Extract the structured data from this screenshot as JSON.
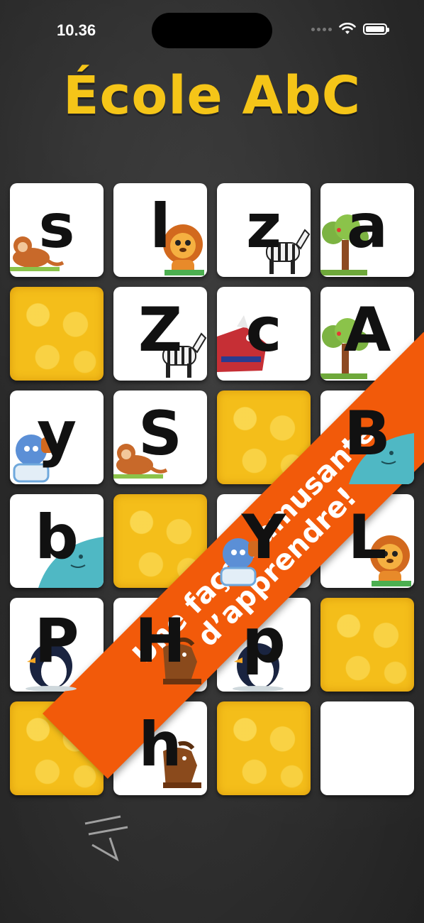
{
  "status_bar": {
    "time": "10.36"
  },
  "app": {
    "title": "École AbC"
  },
  "grid": {
    "cards": [
      {
        "state": "face",
        "letter": "s",
        "animal": "monkey-icon",
        "color": "#c8692a"
      },
      {
        "state": "face",
        "letter": "l",
        "animal": "lion-icon",
        "color": "#e88a2a"
      },
      {
        "state": "face",
        "letter": "z",
        "animal": "zebra-icon",
        "color": "#dddddd"
      },
      {
        "state": "face",
        "letter": "a",
        "animal": "tree-icon",
        "color": "#7cb342"
      },
      {
        "state": "back",
        "letter": "",
        "animal": "",
        "color": ""
      },
      {
        "state": "face",
        "letter": "Z",
        "animal": "zebra-icon",
        "color": "#dddddd"
      },
      {
        "state": "face",
        "letter": "c",
        "animal": "rhino-icon",
        "color": "#c62f35"
      },
      {
        "state": "face",
        "letter": "A",
        "animal": "tree-icon",
        "color": "#7cb342"
      },
      {
        "state": "face",
        "letter": "y",
        "animal": "yeti-icon",
        "color": "#5b8fd6"
      },
      {
        "state": "face",
        "letter": "S",
        "animal": "monkey-icon",
        "color": "#c8692a"
      },
      {
        "state": "back",
        "letter": "",
        "animal": "",
        "color": ""
      },
      {
        "state": "face",
        "letter": "B",
        "animal": "whale-icon",
        "color": "#4fb8c4"
      },
      {
        "state": "face",
        "letter": "b",
        "animal": "whale-icon",
        "color": "#4fb8c4"
      },
      {
        "state": "back",
        "letter": "",
        "animal": "",
        "color": ""
      },
      {
        "state": "face",
        "letter": "Y",
        "animal": "yeti-icon",
        "color": "#5b8fd6"
      },
      {
        "state": "face",
        "letter": "L",
        "animal": "lion-icon",
        "color": "#e88a2a"
      },
      {
        "state": "face",
        "letter": "P",
        "animal": "penguin-icon",
        "color": "#1a2440"
      },
      {
        "state": "face",
        "letter": "H",
        "animal": "horse-icon",
        "color": "#8a4a1c"
      },
      {
        "state": "face",
        "letter": "p",
        "animal": "penguin-icon",
        "color": "#1a2440"
      },
      {
        "state": "back",
        "letter": "",
        "animal": "",
        "color": ""
      },
      {
        "state": "back",
        "letter": "",
        "animal": "",
        "color": ""
      },
      {
        "state": "face",
        "letter": "h",
        "animal": "horse-icon",
        "color": "#8a4a1c"
      },
      {
        "state": "back",
        "letter": "",
        "animal": "",
        "color": ""
      },
      {
        "state": "face",
        "letter": "",
        "animal": "",
        "color": ""
      }
    ]
  },
  "banner": {
    "line1": "Une façon amusante",
    "line2": "d’apprendre!",
    "color": "#f25a0a"
  }
}
